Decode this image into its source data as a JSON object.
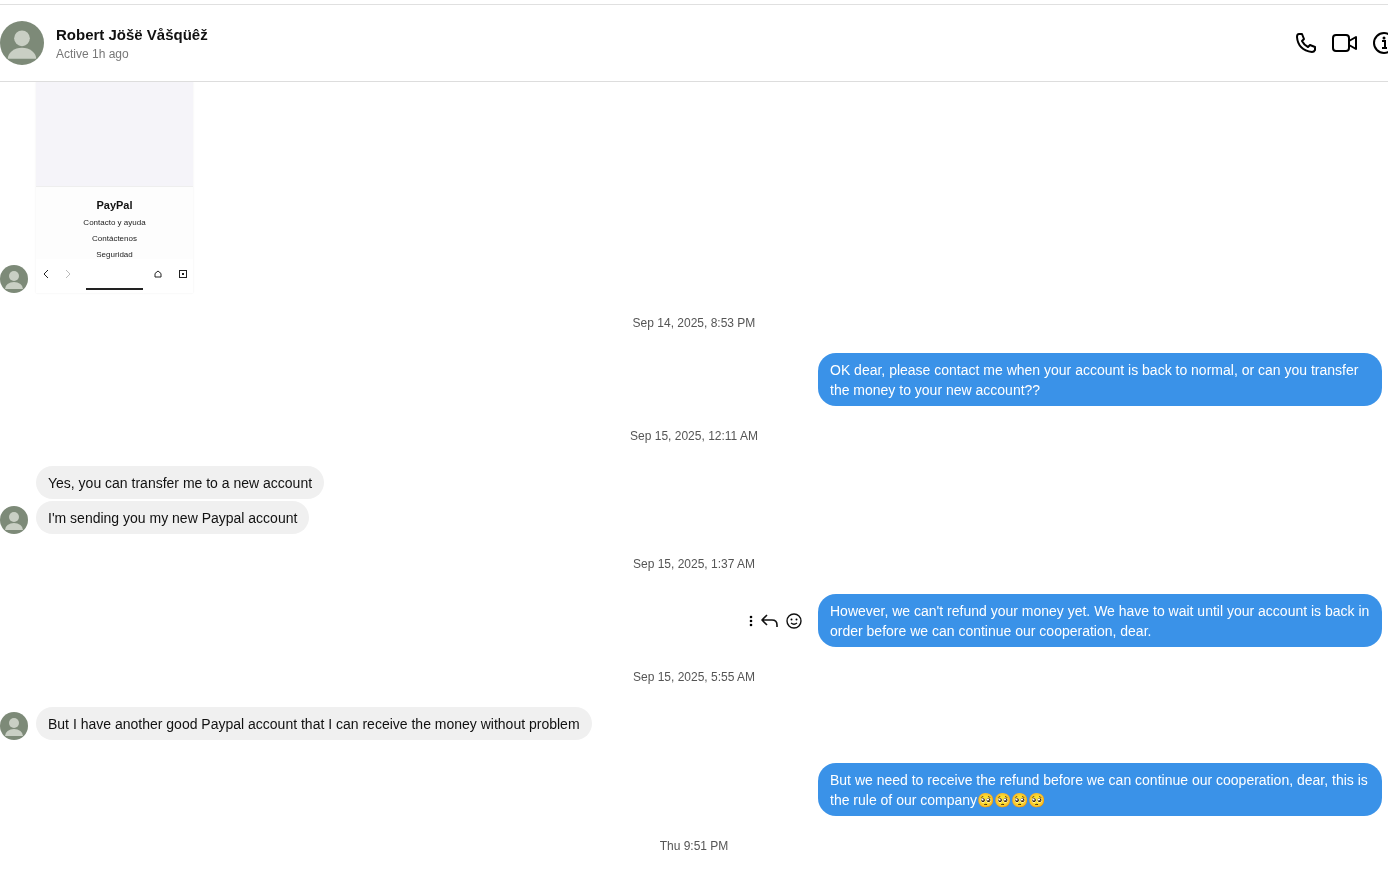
{
  "header": {
    "name": "Robert Jöšë Våšqüêž",
    "status": "Active 1h ago"
  },
  "messages": [
    {
      "kind": "image",
      "title": "PayPal",
      "links": [
        "Contacto y ayuda",
        "Contáctenos",
        "Seguridad"
      ]
    },
    {
      "kind": "timestamp",
      "text": "Sep 14, 2025, 8:53 PM"
    },
    {
      "kind": "outgoing",
      "texts": [
        "OK dear, please contact me when your account is back to normal, or can you transfer the money to your new account??"
      ],
      "hovered": false
    },
    {
      "kind": "timestamp",
      "text": "Sep 15, 2025, 12:11 AM"
    },
    {
      "kind": "incoming",
      "texts": [
        "Yes, you can transfer me to a new account",
        "I'm sending you my new Paypal account"
      ]
    },
    {
      "kind": "timestamp",
      "text": "Sep 15, 2025, 1:37 AM"
    },
    {
      "kind": "outgoing",
      "texts": [
        "However, we can't refund your money yet. We have to wait until your account is back in order before we can continue our cooperation, dear."
      ],
      "hovered": true
    },
    {
      "kind": "timestamp",
      "text": "Sep 15, 2025, 5:55 AM"
    },
    {
      "kind": "incoming",
      "texts": [
        "But I have another good Paypal account that I can receive the money without problem"
      ]
    },
    {
      "kind": "outgoing",
      "texts": [
        "But we need to receive the refund before we can continue our cooperation, dear, this is the rule of our company🥺🥺🥺🥺"
      ],
      "hovered": false
    },
    {
      "kind": "timestamp",
      "text": "Thu 9:51 PM"
    }
  ]
}
